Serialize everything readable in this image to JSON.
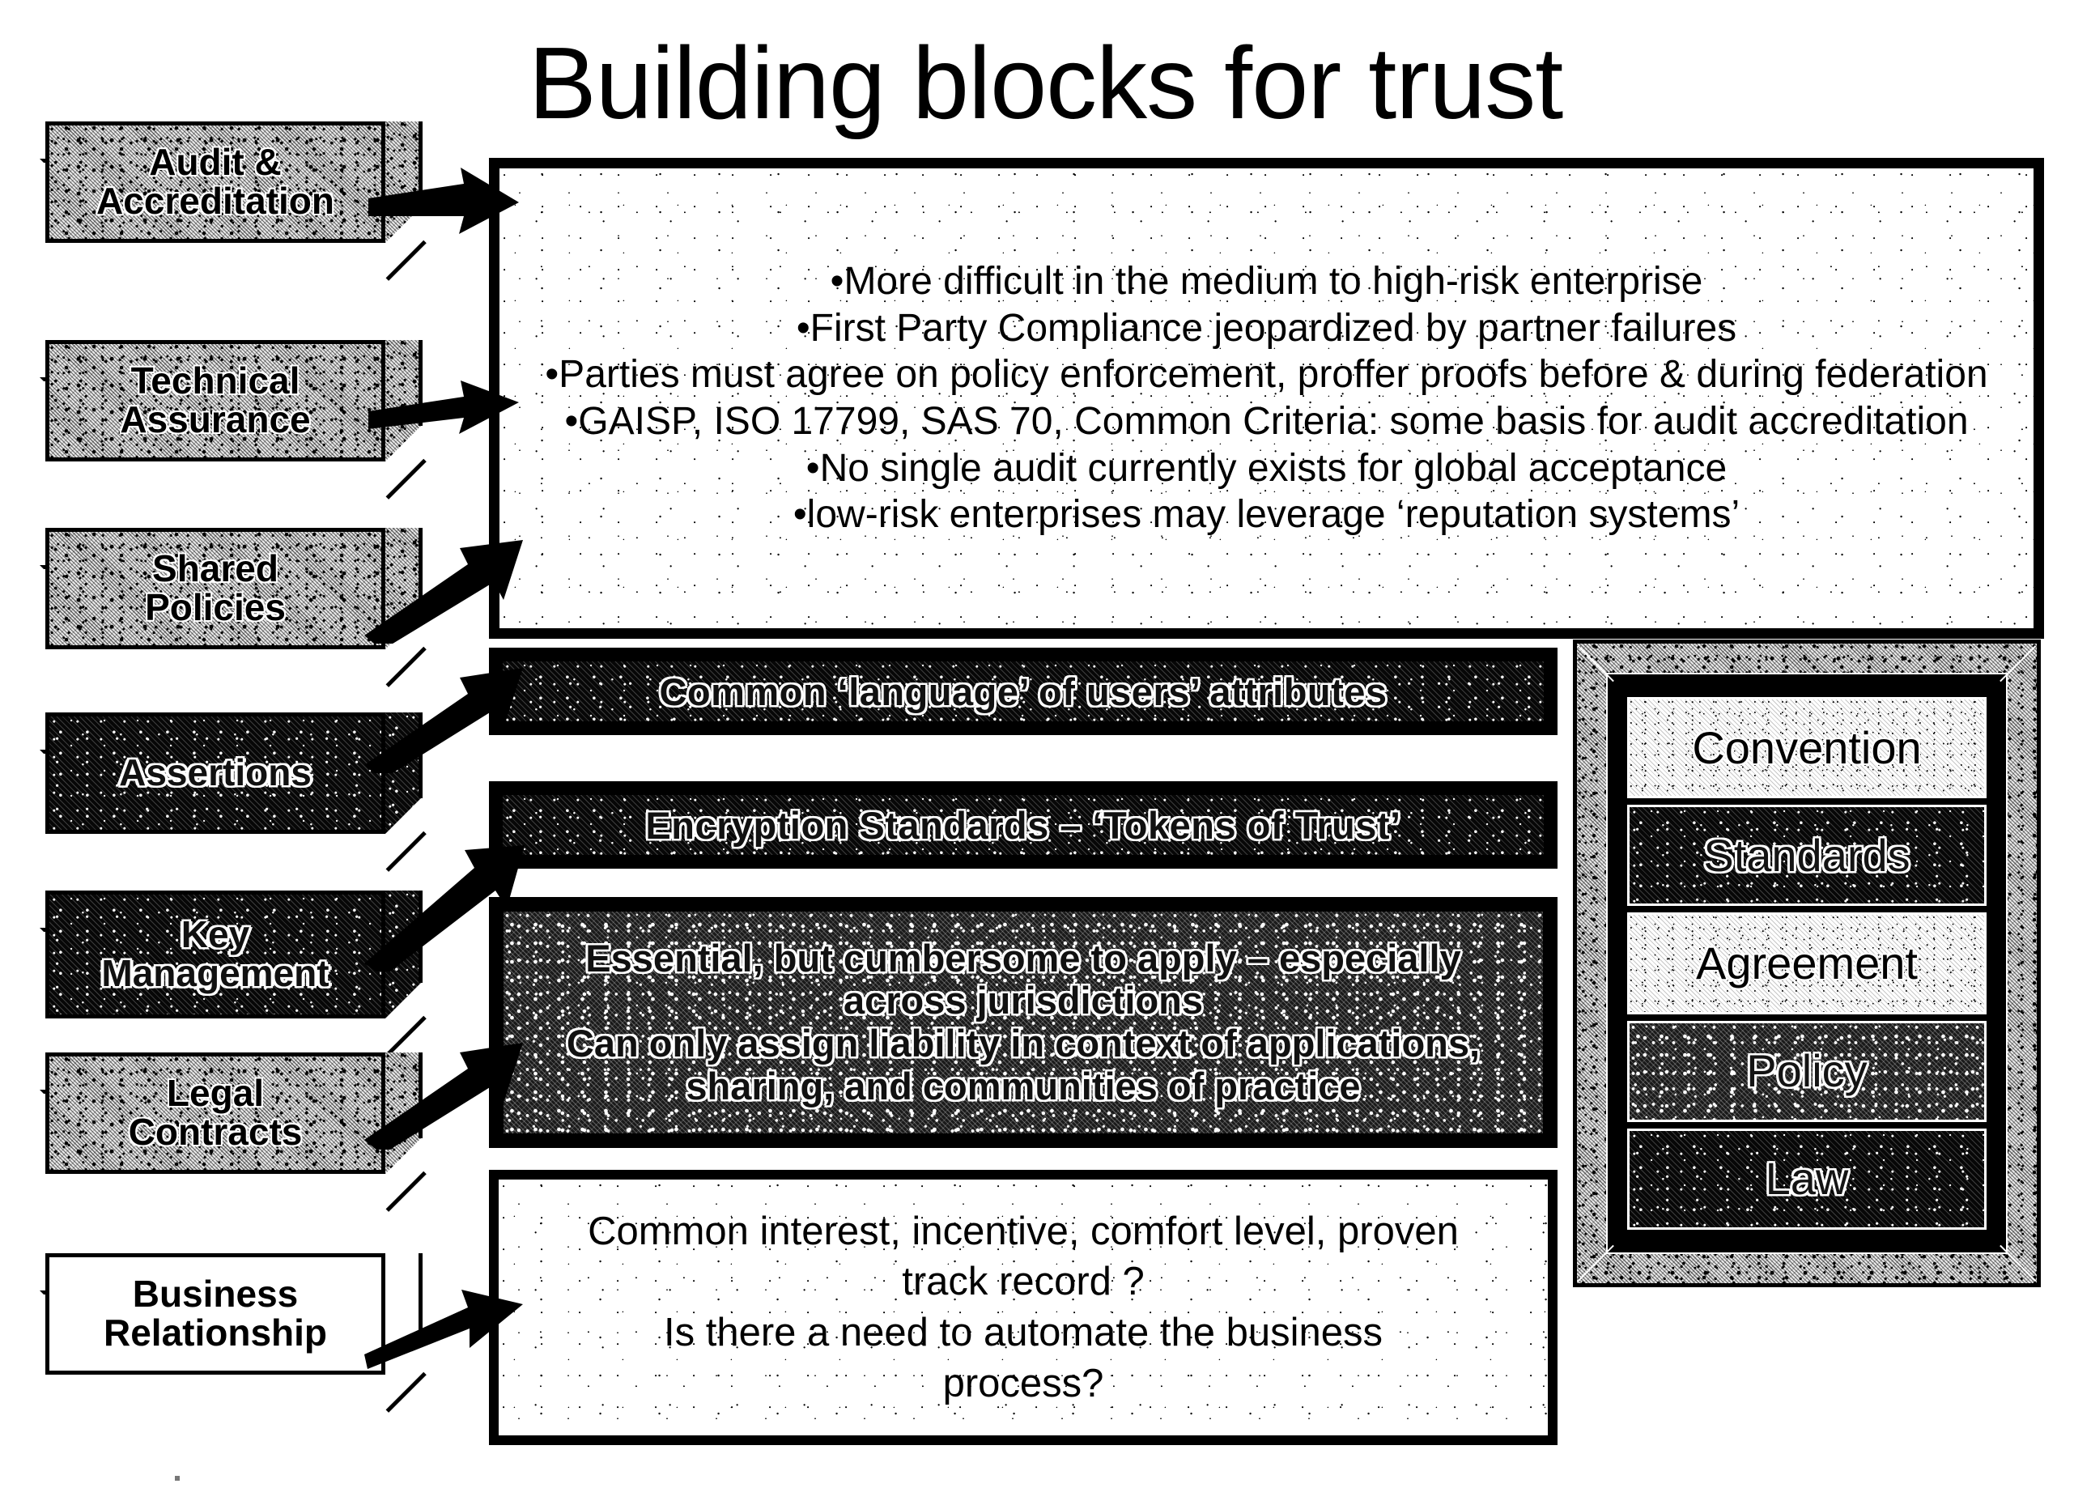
{
  "slide": {
    "title": "Building blocks for trust"
  },
  "blocks": [
    {
      "line1": "Audit &",
      "line2": "Accreditation",
      "style": "light"
    },
    {
      "line1": "Technical",
      "line2": "Assurance",
      "style": "light"
    },
    {
      "line1": "Shared",
      "line2": "Policies",
      "style": "light"
    },
    {
      "line1": "Assertions",
      "line2": "",
      "style": "dark"
    },
    {
      "line1": "Key",
      "line2": "Management",
      "style": "dark"
    },
    {
      "line1": "Legal",
      "line2": "Contracts",
      "style": "light"
    },
    {
      "line1": "Business",
      "line2": "Relationship",
      "style": "plain"
    }
  ],
  "main_panel": {
    "bullets": [
      "•More difficult in the medium to high-risk enterprise",
      "•First Party Compliance jeopardized by partner failures",
      "•Parties must agree on policy enforcement, proffer proofs before & during federation",
      "•GAISP, ISO 17799, SAS 70, Common Criteria: some basis for audit accreditation",
      "•No single audit currently exists for global acceptance",
      "•low-risk enterprises may leverage ‘reputation systems’"
    ]
  },
  "bar_assertions": {
    "text": "Common ‘language’ of users’ attributes"
  },
  "bar_keymanagement": {
    "text": "Encryption Standards – ‘Tokens of Trust’"
  },
  "panel_legal": {
    "lines": [
      "Essential, but cumbersome to apply – especially",
      "across jurisdictions",
      "Can only assign liability in context of applications,",
      "sharing, and communities of practice"
    ]
  },
  "panel_business": {
    "lines": [
      "Common interest, incentive, comfort level, proven",
      "track record ?",
      "Is there a need to automate the business",
      "process?"
    ]
  },
  "right_stack": {
    "items": [
      {
        "label": "Convention",
        "style": "lt"
      },
      {
        "label": "Standards",
        "style": "dk"
      },
      {
        "label": "Agreement",
        "style": "lt"
      },
      {
        "label": "Policy",
        "style": "dk"
      },
      {
        "label": "Law",
        "style": "dk"
      }
    ]
  },
  "colors": {
    "ink": "#000000",
    "paper": "#ffffff"
  }
}
